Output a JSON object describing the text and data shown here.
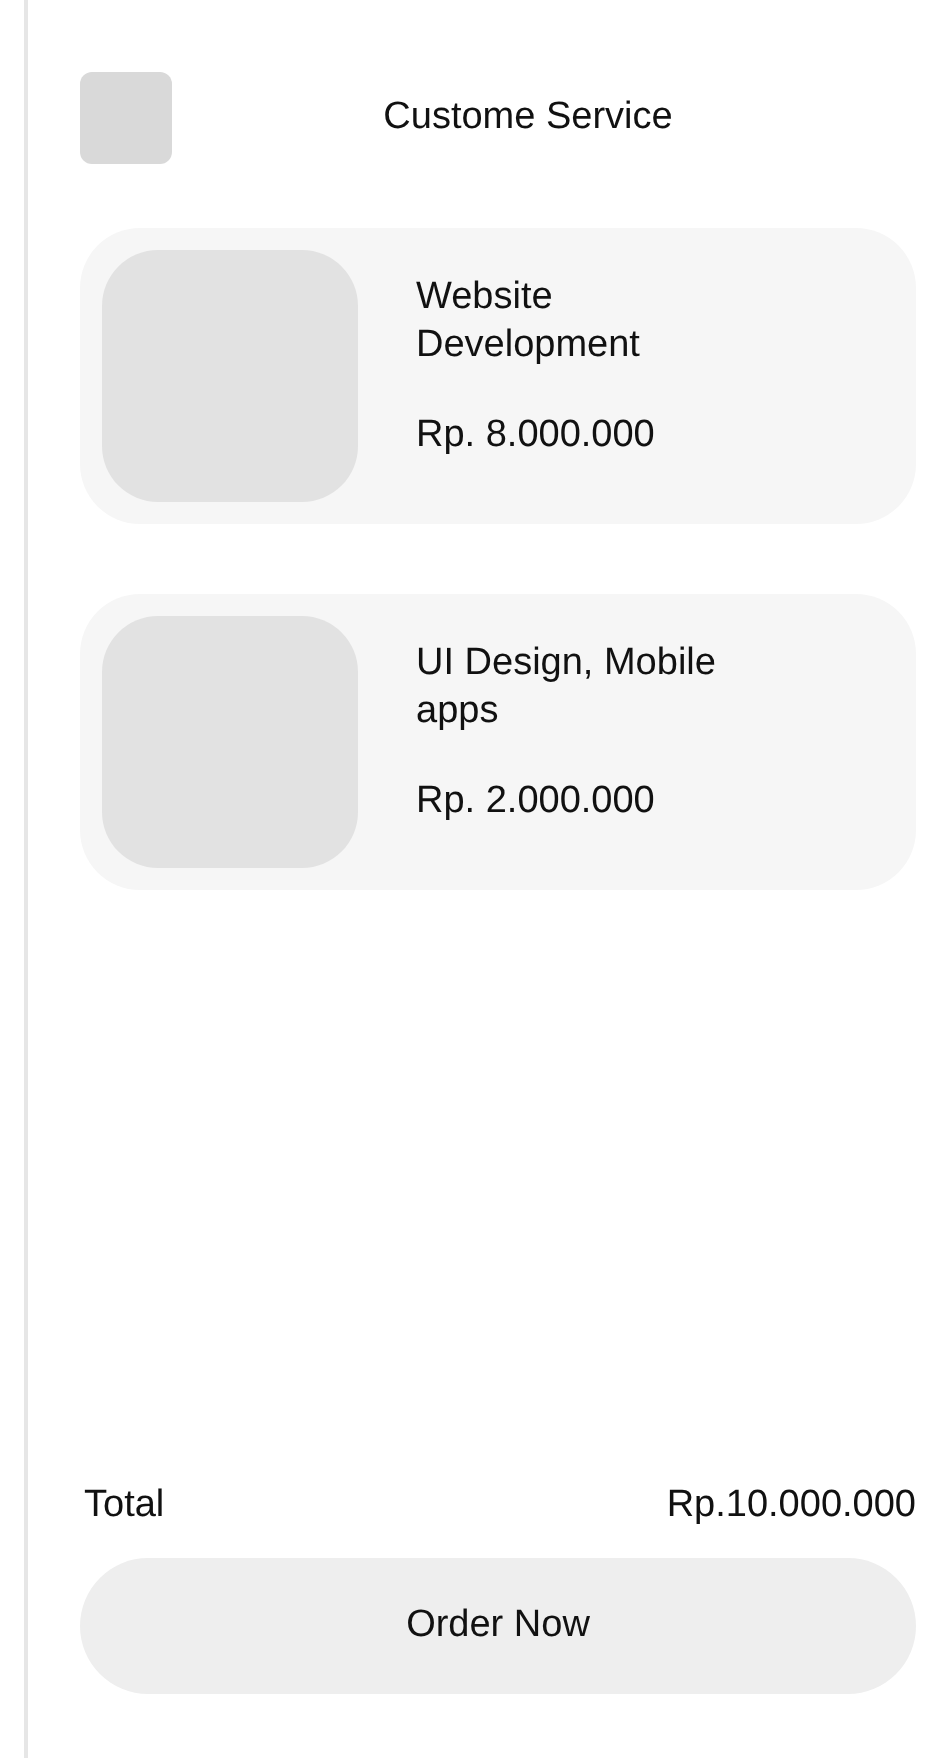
{
  "header": {
    "title": "Custome Service"
  },
  "items": [
    {
      "title": "Website Development",
      "price": "Rp. 8.000.000"
    },
    {
      "title": "UI Design, Mobile apps",
      "price": "Rp. 2.000.000"
    }
  ],
  "total": {
    "label": "Total",
    "value": "Rp.10.000.000"
  },
  "button": {
    "label": "Order Now"
  }
}
